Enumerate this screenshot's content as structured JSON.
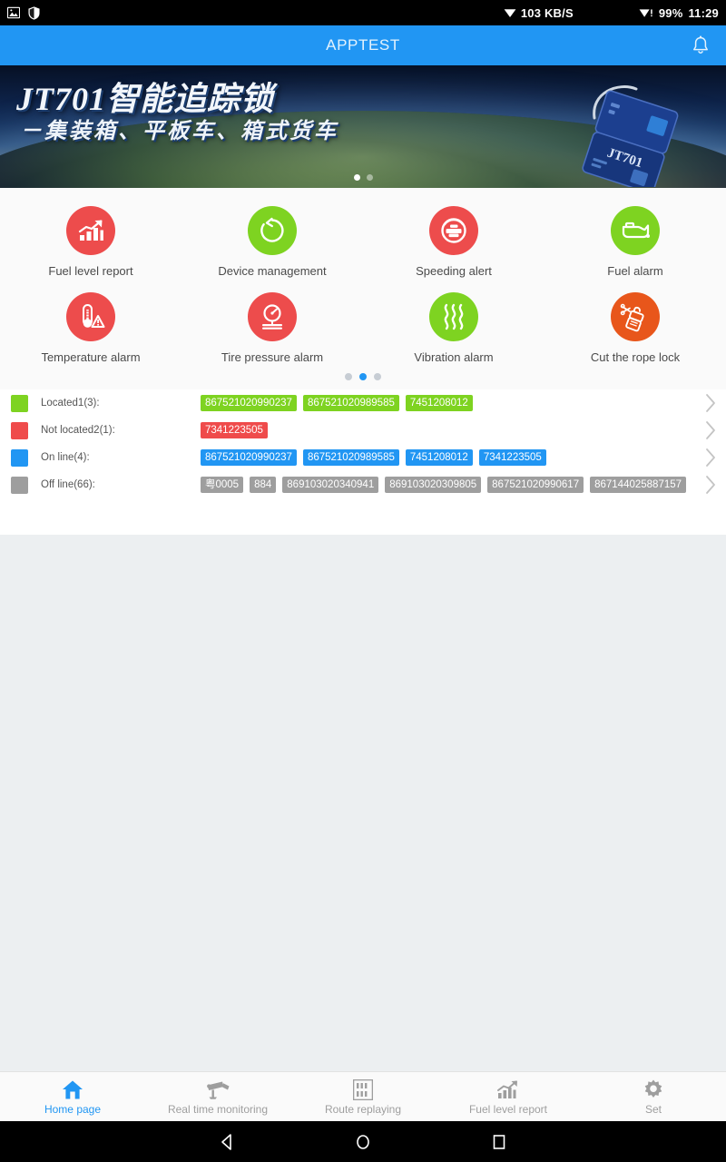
{
  "statusbar": {
    "left_icons": [
      "image-icon",
      "shield-icon"
    ],
    "net_speed": "103 KB/S",
    "net_icon": "wifi-icon",
    "signal_icon": "wifi-alert-icon",
    "battery": "99%",
    "time": "11:29"
  },
  "appbar": {
    "title": "APPTEST",
    "bell_icon": "bell-icon"
  },
  "banner": {
    "title": "JT701智能追踪锁",
    "subtitle": "－集装箱、平板车、箱式货车",
    "device_label": "JT701",
    "dots_total": 2,
    "dots_active": 0
  },
  "grid": {
    "items": [
      {
        "label": "Fuel level report",
        "icon": "fuel-level-chart-icon",
        "color": "#ed4c4c"
      },
      {
        "label": "Device management",
        "icon": "device-refresh-icon",
        "color": "#7ed321"
      },
      {
        "label": "Speeding alert",
        "icon": "speeding-car-icon",
        "color": "#ed4c4c"
      },
      {
        "label": "Fuel alarm",
        "icon": "oil-can-icon",
        "color": "#7ed321"
      },
      {
        "label": "Temperature alarm",
        "icon": "thermometer-alert-icon",
        "color": "#ed4c4c"
      },
      {
        "label": "Tire pressure alarm",
        "icon": "tire-gauge-icon",
        "color": "#ed4c4c"
      },
      {
        "label": "Vibration alarm",
        "icon": "vibration-waves-icon",
        "color": "#7ed321"
      },
      {
        "label": "Cut the rope lock",
        "icon": "cut-rope-lock-icon",
        "color": "#e8561b"
      }
    ],
    "dots_total": 3,
    "dots_active": 1
  },
  "status_list": {
    "rows": [
      {
        "label": "Located1(3):",
        "color": "#7ed321",
        "tags": [
          "867521020990237",
          "867521020989585",
          "7451208012"
        ],
        "chevron_icon": "chevron-right-icon"
      },
      {
        "label": "Not located2(1):",
        "color": "#ef4b4b",
        "tags": [
          "7341223505"
        ],
        "chevron_icon": "chevron-right-icon"
      },
      {
        "label": "On line(4):",
        "color": "#2196f3",
        "tags": [
          "867521020990237",
          "867521020989585",
          "7451208012",
          "7341223505"
        ],
        "chevron_icon": "chevron-right-icon"
      },
      {
        "label": "Off line(66):",
        "color": "#9e9e9e",
        "tags": [
          "粤0005",
          "884",
          "869103020340941",
          "869103020309805",
          "867521020990617",
          "867144025887157"
        ],
        "chevron_icon": "chevron-right-icon"
      }
    ]
  },
  "tabbar": {
    "items": [
      {
        "label": "Home page",
        "icon": "home-icon",
        "active": true
      },
      {
        "label": "Real time monitoring",
        "icon": "cctv-camera-icon",
        "active": false
      },
      {
        "label": "Route replaying",
        "icon": "route-grid-icon",
        "active": false
      },
      {
        "label": "Fuel level report",
        "icon": "chart-up-icon",
        "active": false
      },
      {
        "label": "Set",
        "icon": "gear-icon",
        "active": false
      }
    ],
    "active_color": "#2196f3",
    "inactive_color": "#9e9e9e"
  },
  "navbar": {
    "back": "back-triangle-icon",
    "home": "home-circle-icon",
    "recents": "recents-square-icon"
  }
}
